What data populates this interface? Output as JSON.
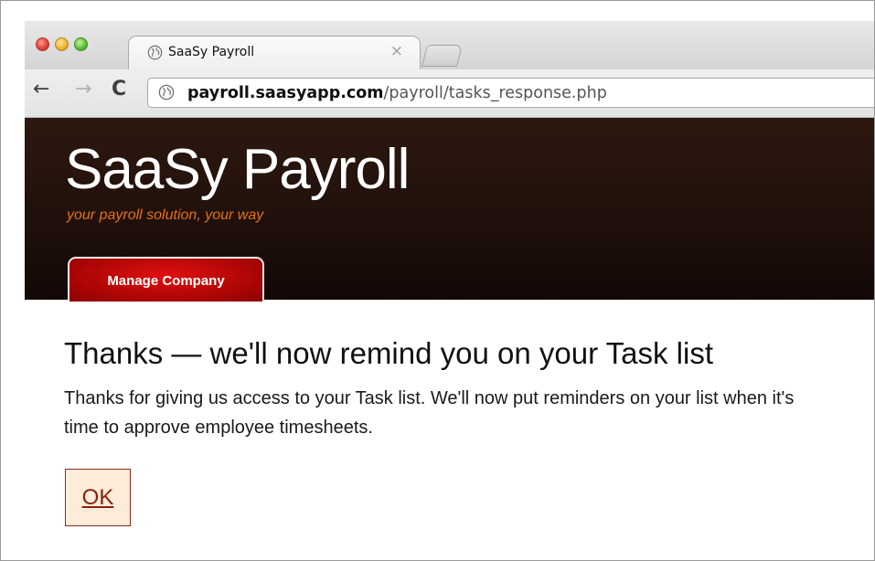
{
  "browser": {
    "tab_title": "SaaSy Payroll",
    "tab_close": "×",
    "nav": {
      "back": "←",
      "forward": "→",
      "reload": "C"
    },
    "url_host": "payroll.saasyapp.com",
    "url_path": "/payroll/tasks_response.php"
  },
  "header": {
    "brand": "SaaSy Payroll",
    "tagline": "your payroll solution, your way",
    "nav_tab": "Manage Company"
  },
  "content": {
    "heading": "Thanks — we'll now remind you on your Task list",
    "message": "Thanks for giving us access to your Task list. We'll now put reminders on your list when it's time to approve employee timesheets.",
    "ok_label": "OK"
  },
  "colors": {
    "banner": "#1f100b",
    "tagline": "#e86f16",
    "nav_tab": "#c00808",
    "ok_background": "#fcecd8",
    "ok_text": "#8a1f10"
  },
  "icons": [
    "globe-icon",
    "close-icon",
    "back-arrow-icon",
    "forward-arrow-icon",
    "reload-icon"
  ]
}
